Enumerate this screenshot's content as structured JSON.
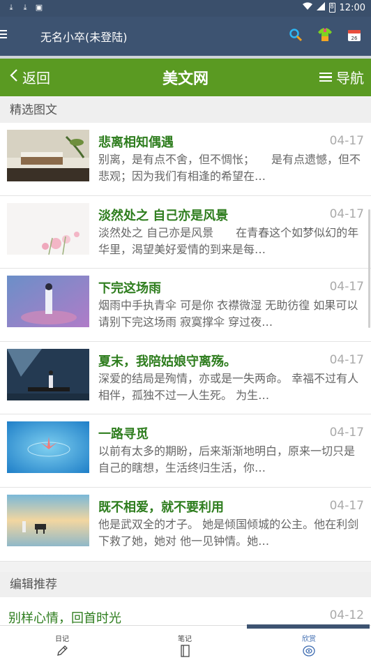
{
  "status": {
    "time": "12:00",
    "battery": "8"
  },
  "app": {
    "title": "无名小卒(未登陆)"
  },
  "nav": {
    "back_label": "返回",
    "site_title": "美文网",
    "guide_label": "导航"
  },
  "sections": {
    "featured": "精选图文",
    "recommended": "编辑推荐"
  },
  "articles": [
    {
      "title": "悲离相知偶遇",
      "date": "04-17",
      "summary": "别离，是有点不舍，但不惆怅；　　是有点遗憾，但不悲观；因为我们有相逢的希望在…"
    },
    {
      "title": "淡然处之 自己亦是风景",
      "date": "04-17",
      "summary": "淡然处之 自己亦是风景　　在青春这个如梦似幻的年华里，渴望美好爱情的到来是每…"
    },
    {
      "title": "下完这场雨",
      "date": "04-17",
      "summary": "烟雨中手执青伞 可是你 衣襟微湿 无助彷徨 如果可以 请别下完这场雨 寂寞撑伞 穿过夜…"
    },
    {
      "title": "夏末，我陪姑娘守离殇。",
      "date": "04-17",
      "summary": "深爱的结局是殉情，亦或是一失两命。 幸福不过有人相伴，孤独不过一人生死。 为生…"
    },
    {
      "title": "一路寻觅",
      "date": "04-17",
      "summary": "以前有太多的期盼，后来渐渐地明白，原来一切只是自己的瞎想，生活终归生活，你…"
    },
    {
      "title": "既不相爱，就不要利用",
      "date": "04-17",
      "summary": "他是武双全的才子。 她是倾国倾城的公主。他在利剑下救了她，她对 他一见钟情。她…"
    }
  ],
  "recommended": [
    {
      "title": "别样心情，回首时光",
      "date": "04-12"
    }
  ],
  "tabs": [
    {
      "label": "日记",
      "icon": "pencil-icon"
    },
    {
      "label": "笔记",
      "icon": "notebook-icon"
    },
    {
      "label": "欣赏",
      "icon": "eye-icon"
    }
  ],
  "colors": {
    "app_bar": "#3d5371",
    "nav_bar": "#5a9a22",
    "title_green": "#2e7d1e",
    "active_tab": "#3d6bb0"
  }
}
